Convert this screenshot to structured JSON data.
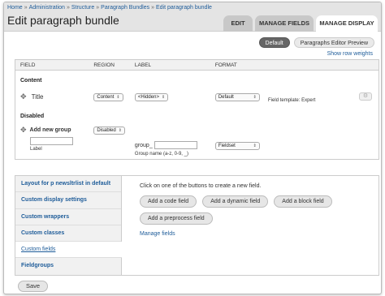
{
  "breadcrumb": [
    "Home",
    "Administration",
    "Structure",
    "Paragraph Bundles",
    "Edit paragraph bundle"
  ],
  "breadcrumb_sep": "»",
  "page_title": "Edit paragraph bundle",
  "tabs": {
    "edit": "Edit",
    "manage_fields": "Manage fields",
    "manage_display": "Manage display"
  },
  "view_modes": {
    "default": "Default",
    "editor_preview": "Paragraphs Editor Preview"
  },
  "show_row_weights": "Show row weights",
  "table": {
    "headers": {
      "field": "FIELD",
      "region": "REGION",
      "label": "LABEL",
      "format": "FORMAT"
    },
    "region_content": "Content",
    "title_row": {
      "field": "Title",
      "region": "Content",
      "label": "<Hidden>",
      "format": "Default",
      "template": "Field template: Expert"
    },
    "region_disabled": "Disabled",
    "new_group": {
      "heading": "Add new group",
      "region": "Disabled",
      "sublabel": "Label",
      "prefix": "group_",
      "hint": "Group name (a-z, 0-9, _)",
      "format": "Fieldset"
    }
  },
  "vertical_tabs": [
    "Layout for p newsltrlist in default",
    "Custom display settings",
    "Custom wrappers",
    "Custom classes",
    "Custom fields",
    "Fieldgroups"
  ],
  "custom_fields_pane": {
    "description": "Click on one of the buttons to create a new field.",
    "buttons": [
      "Add a code field",
      "Add a dynamic field",
      "Add a block field",
      "Add a preprocess field"
    ],
    "manage_link": "Manage fields"
  },
  "save_label": "Save",
  "icons": {
    "drag": "drag-handle-icon",
    "gear": "gear-icon",
    "dropdown": "chevron-down-icon"
  },
  "colors": {
    "link": "#1e5c99",
    "active_view_mode": "#666666"
  }
}
